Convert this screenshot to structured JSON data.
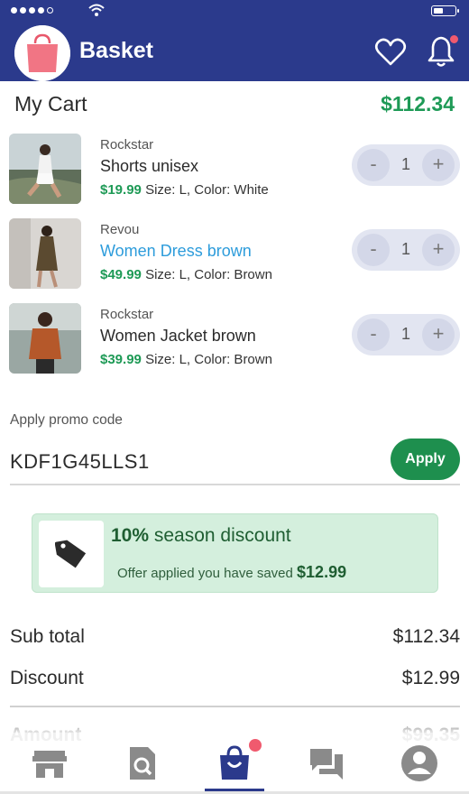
{
  "status_bar": {
    "battery_level": 0.45
  },
  "header": {
    "title": "Basket"
  },
  "cart": {
    "title": "My Cart",
    "total": "$112.34",
    "items": [
      {
        "brand": "Rockstar",
        "name": "Shorts unisex",
        "price": "$19.99",
        "details": "Size: L, Color: White",
        "quantity": "1",
        "minus": "-",
        "plus": "+"
      },
      {
        "brand": "Revou",
        "name": "Women Dress brown",
        "price": "$49.99",
        "details": "Size: L, Color: Brown",
        "quantity": "1",
        "minus": "-",
        "plus": "+"
      },
      {
        "brand": "Rockstar",
        "name": "Women Jacket brown",
        "price": "$39.99",
        "details": "Size: L, Color: Brown",
        "quantity": "1",
        "minus": "-",
        "plus": "+"
      }
    ]
  },
  "promo": {
    "label": "Apply promo code",
    "value": "KDF1G45LLS1",
    "apply_label": "Apply"
  },
  "discount": {
    "percent": "10%",
    "title": "season discount",
    "subtitle": "Offer applied you have saved",
    "saved": "$12.99"
  },
  "totals": {
    "subtotal_label": "Sub total",
    "subtotal_value": "$112.34",
    "discount_label": "Discount",
    "discount_value": "$12.99",
    "amount_label": "Amount",
    "amount_value": "$99.35"
  },
  "bottom_nav": {
    "active": "basket",
    "items": [
      "store-icon",
      "search-icon",
      "basket-icon",
      "chat-icon",
      "profile-icon"
    ]
  },
  "colors": {
    "brand": "#2b3a8c",
    "price_green": "#1e9a56",
    "link_blue": "#2d9cdb",
    "badge": "#f05a6e",
    "discount_bg": "#d4efdd"
  }
}
